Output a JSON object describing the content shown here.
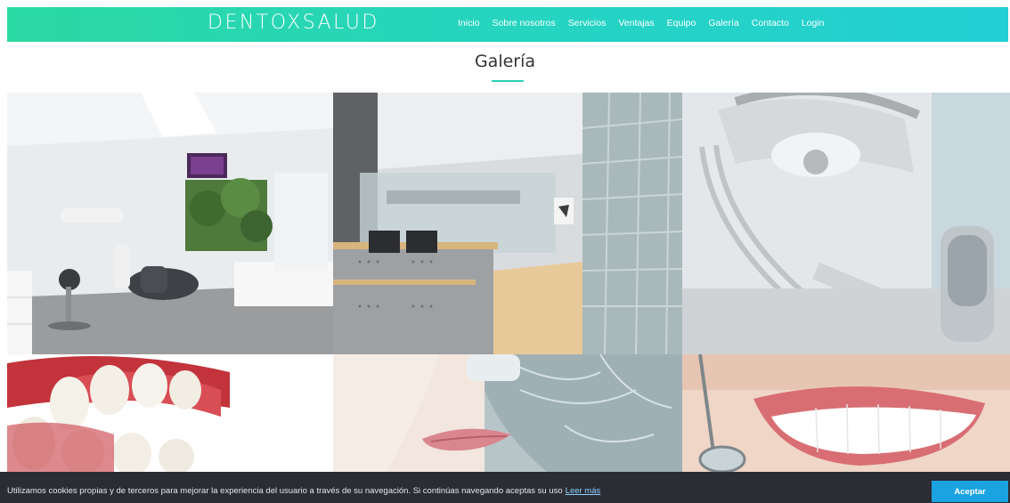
{
  "header": {
    "logo": "DENTOXSALUD",
    "nav": [
      "Inicio",
      "Sobre nosotros",
      "Servicios",
      "Ventajas",
      "Equipo",
      "Galería",
      "Contacto",
      "Login"
    ]
  },
  "gallery": {
    "title": "Galería",
    "photos": [
      "dental-operatory-photo",
      "clinic-reception-photo",
      "dental-lamp-closeup-photo",
      "teeth-model-photo",
      "jaw-xray-overlay-photo",
      "smile-with-mirror-photo"
    ]
  },
  "cookie_bar": {
    "text": "Utilizamos cookies propias y de terceros para mejorar la experiencia del usuario a través de su navegación. Si continúas navegando aceptas su uso",
    "link": "Leer más",
    "accept": "Aceptar"
  },
  "colors": {
    "header_gradient_start": "#2bd9a3",
    "header_gradient_end": "#22cfd4",
    "accent": "#2fd1b9",
    "cookie_bg": "#2a2d34",
    "accept_button": "#1aa3e0"
  }
}
